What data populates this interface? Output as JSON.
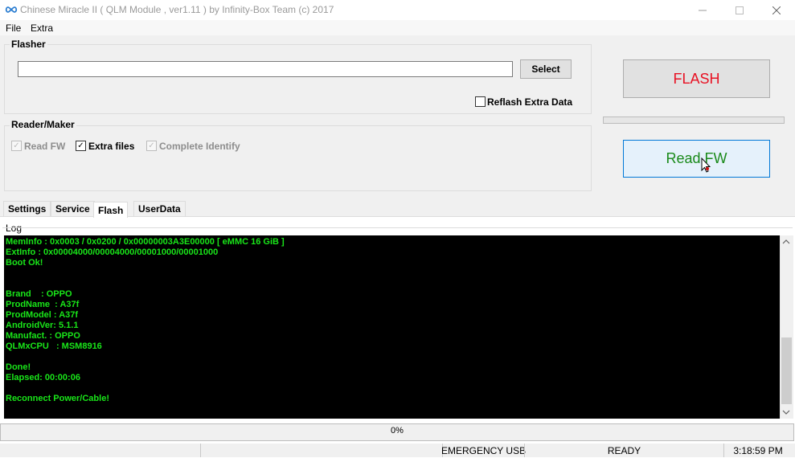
{
  "window": {
    "title": "Chinese Miracle II ( QLM Module , ver1.11  ) by Infinity-Box Team (c) 2017",
    "icon": "infinity-icon"
  },
  "menu": {
    "items": [
      "File",
      "Extra"
    ]
  },
  "flasher": {
    "label": "Flasher",
    "path_value": "",
    "select_label": "Select",
    "reflash_label": "Reflash Extra Data",
    "reflash_checked": false
  },
  "reader": {
    "label": "Reader/Maker",
    "read_fw_label": "Read FW",
    "read_fw_checked": true,
    "read_fw_enabled": false,
    "extra_files_label": "Extra files",
    "extra_files_checked": true,
    "complete_identify_label": "Complete Identify",
    "complete_identify_checked": true,
    "complete_identify_enabled": false
  },
  "actions": {
    "flash_label": "FLASH",
    "flash_color": "#e81123",
    "read_label": "Read FW",
    "read_color": "#1a8a1a"
  },
  "tabs": [
    {
      "label": "Settings",
      "active": false
    },
    {
      "label": "Service",
      "active": false
    },
    {
      "label": "Flash",
      "active": true
    },
    {
      "label": "UserData",
      "active": false
    }
  ],
  "log": {
    "label": "Log",
    "text_color": "#19e619",
    "lines": [
      "MemInfo : 0x0003 / 0x0200 / 0x00000003A3E00000 [ eMMC 16 GiB ]",
      "ExtInfo : 0x00004000/00004000/00001000/00001000",
      "Boot Ok!",
      "",
      "",
      "Brand    : OPPO",
      "ProdName  : A37f",
      "ProdModel : A37f",
      "AndroidVer: 5.1.1",
      "Manufact. : OPPO",
      "QLMxCPU   : MSM8916",
      "",
      "Done!",
      "Elapsed: 00:00:06",
      "",
      "Reconnect Power/Cable!"
    ]
  },
  "progress": {
    "text": "0%",
    "value": 0
  },
  "status": {
    "connection": "EMERGENCY USB",
    "state": "READY",
    "time": "3:18:59 PM"
  }
}
